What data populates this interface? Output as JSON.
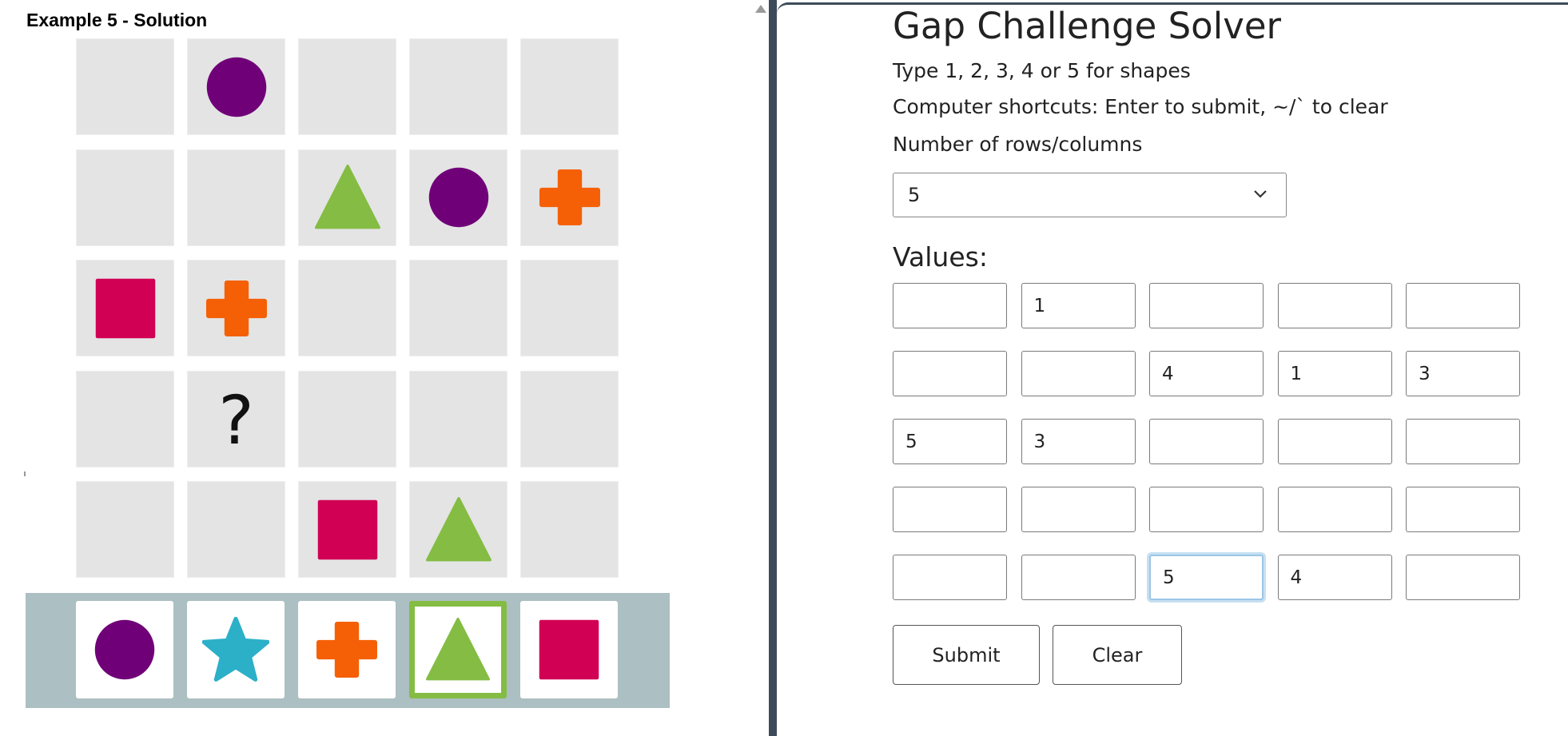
{
  "example_title": "Example 5 - Solution",
  "puzzle": {
    "grid": [
      [
        "",
        "circle",
        "",
        "",
        ""
      ],
      [
        "",
        "",
        "triangle",
        "circle",
        "cross"
      ],
      [
        "square",
        "cross",
        "",
        "",
        ""
      ],
      [
        "",
        "?",
        "",
        "",
        ""
      ],
      [
        "",
        "",
        "square",
        "triangle",
        ""
      ]
    ],
    "question_mark": "?",
    "options": [
      "circle",
      "star",
      "cross",
      "triangle",
      "square"
    ],
    "selected_option": "triangle",
    "colors": {
      "circle": "#700078",
      "star": "#2bb0c8",
      "cross": "#f56006",
      "triangle": "#84bc44",
      "square": "#d10055"
    }
  },
  "solver": {
    "title": "Gap Challenge Solver",
    "instructions": "Type 1, 2, 3, 4 or 5 for shapes",
    "shortcuts": "Computer shortcuts: Enter to submit, ~/` to clear",
    "rows_label": "Number of rows/columns",
    "rows_value": "5",
    "values_label": "Values:",
    "values": [
      [
        "",
        "1",
        "",
        "",
        ""
      ],
      [
        "",
        "",
        "4",
        "1",
        "3"
      ],
      [
        "5",
        "3",
        "",
        "",
        ""
      ],
      [
        "",
        "",
        "",
        "",
        ""
      ],
      [
        "",
        "",
        "5",
        "4",
        ""
      ]
    ],
    "focused_cell": "4,2",
    "submit_label": "Submit",
    "clear_label": "Clear"
  }
}
